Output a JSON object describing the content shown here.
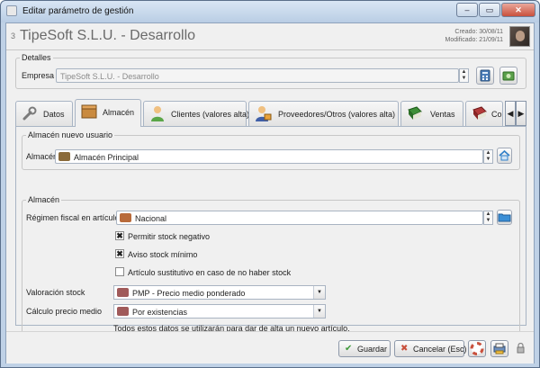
{
  "window": {
    "title": "Editar parámetro de gestión",
    "controls": {
      "minimize": "–",
      "maximize": "▭",
      "close": "✕"
    }
  },
  "record": {
    "id": "3",
    "title": "TipeSoft S.L.U. - Desarrollo",
    "created": "Creado: 30/08/11",
    "modified": "Modificado: 21/09/11"
  },
  "detalles": {
    "legend": "Detalles",
    "empresa_label": "Empresa",
    "empresa_value": "TipeSoft S.L.U. - Desarrollo"
  },
  "tabs": [
    {
      "label": "Datos",
      "icon": "wrench-icon"
    },
    {
      "label": "Almacén",
      "icon": "box-icon"
    },
    {
      "label": "Clientes (valores alta)",
      "icon": "person-icon"
    },
    {
      "label": "Proveedores/Otros (valores alta)",
      "icon": "supplier-icon"
    },
    {
      "label": "Ventas",
      "icon": "green-book-icon"
    },
    {
      "label": "Co",
      "icon": "red-book-icon"
    }
  ],
  "active_tab": "Almacén",
  "almacen_nuevo_usuario": {
    "legend": "Almacén nuevo usuario",
    "almacen_label": "Almacén",
    "almacen_value": "Almacén Principal"
  },
  "almacen": {
    "legend": "Almacén",
    "regimen_label": "Régimen fiscal en artículos",
    "regimen_value": "Nacional",
    "checkboxes": [
      {
        "label": "Permitir stock negativo",
        "checked": true,
        "mark": "✖"
      },
      {
        "label": "Aviso stock mínimo",
        "checked": true,
        "mark": "✖"
      },
      {
        "label": "Artículo sustitutivo en caso de no haber stock",
        "checked": false,
        "mark": ""
      }
    ],
    "valoracion_label": "Valoración stock",
    "valoracion_value": "PMP - Precio medio ponderado",
    "calculo_label": "Cálculo precio medio",
    "calculo_value": "Por existencias",
    "note": "Todos estos datos se utilizarán para dar de alta un nuevo artículo."
  },
  "footer": {
    "guardar": "Guardar",
    "cancelar": "Cancelar (Esc)",
    "guardar_icon": "✔",
    "cancelar_icon": "✖"
  },
  "colors": {
    "titlebar": "#c9d9ec",
    "client_bg": "#f0f0f0",
    "accent_green": "#3f9a3a",
    "accent_red": "#c9503c"
  }
}
